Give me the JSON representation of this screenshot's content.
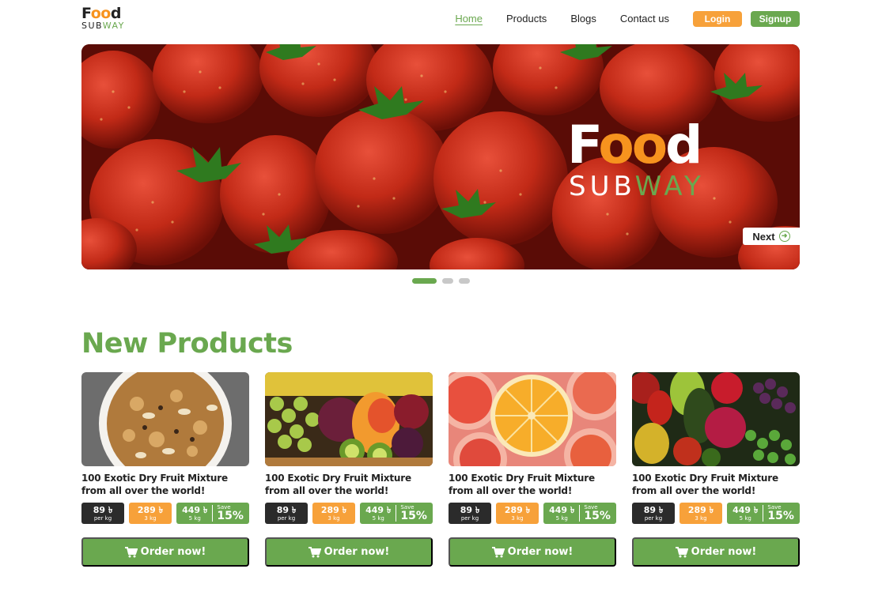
{
  "header": {
    "logo_top_prefix": "F",
    "logo_top_oo": "oo",
    "logo_top_suffix": "d",
    "logo_bottom_prefix": "SUB",
    "logo_bottom_way": "WAY",
    "nav": [
      {
        "label": "Home",
        "active": true
      },
      {
        "label": "Products",
        "active": false
      },
      {
        "label": "Blogs",
        "active": false
      },
      {
        "label": "Contact us",
        "active": false
      }
    ],
    "login_label": "Login",
    "signup_label": "Signup"
  },
  "hero": {
    "logo_top_prefix": "F",
    "logo_top_oo": "oo",
    "logo_top_suffix": "d",
    "logo_bottom_prefix": "SUB",
    "logo_bottom_way": "WAY",
    "next_label": "Next",
    "slides_total": 3,
    "active_slide": 1
  },
  "section": {
    "title": "New Products"
  },
  "products": [
    {
      "title": "100 Exotic Dry Fruit Mixture from all over the world!",
      "image": "granola-bowl",
      "prices": [
        {
          "amount": "89 ৳",
          "unit": "per kg"
        },
        {
          "amount": "289 ৳",
          "unit": "3 kg"
        },
        {
          "amount": "449 ৳",
          "unit": "5 kg"
        }
      ],
      "save_label": "Save",
      "save_pct": "15%",
      "order_label": "Order now!"
    },
    {
      "title": "100 Exotic Dry Fruit Mixture from all over the world!",
      "image": "fruit-basket",
      "prices": [
        {
          "amount": "89 ৳",
          "unit": "per kg"
        },
        {
          "amount": "289 ৳",
          "unit": "3 kg"
        },
        {
          "amount": "449 ৳",
          "unit": "5 kg"
        }
      ],
      "save_label": "Save",
      "save_pct": "15%",
      "order_label": "Order now!"
    },
    {
      "title": "100 Exotic Dry Fruit Mixture from all over the world!",
      "image": "citrus-slices",
      "prices": [
        {
          "amount": "89 ৳",
          "unit": "per kg"
        },
        {
          "amount": "289 ৳",
          "unit": "3 kg"
        },
        {
          "amount": "449 ৳",
          "unit": "5 kg"
        }
      ],
      "save_label": "Save",
      "save_pct": "15%",
      "order_label": "Order now!"
    },
    {
      "title": "100 Exotic Dry Fruit Mixture from all over the world!",
      "image": "mixed-fruits",
      "prices": [
        {
          "amount": "89 ৳",
          "unit": "per kg"
        },
        {
          "amount": "289 ৳",
          "unit": "3 kg"
        },
        {
          "amount": "449 ৳",
          "unit": "5 kg"
        }
      ],
      "save_label": "Save",
      "save_pct": "15%",
      "order_label": "Order now!"
    }
  ],
  "colors": {
    "brand_green": "#6aa84f",
    "brand_orange": "#f7a13a",
    "dark": "#2b2b2b"
  }
}
